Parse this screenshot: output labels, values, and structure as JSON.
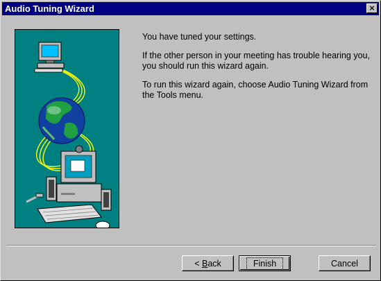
{
  "window": {
    "title": "Audio Tuning Wizard",
    "close_label": "×"
  },
  "illustration": {
    "icons": [
      "computer-icon",
      "globe-icon",
      "desktop-computer-icon",
      "speaker-icon",
      "microphone-icon",
      "mouse-icon",
      "keyboard-icon"
    ],
    "colors": {
      "background": "#008080",
      "cable": "#ffff00"
    }
  },
  "content": {
    "paragraphs": [
      "You have tuned your settings.",
      "If the other person in your meeting has trouble hearing you, you should run this wizard again.",
      "To run this wizard again, choose Audio Tuning Wizard from the Tools menu."
    ]
  },
  "buttons": {
    "back_prefix": "< ",
    "back_mnemonic": "B",
    "back_rest": "ack",
    "finish_label": "Finish",
    "cancel_label": "Cancel"
  },
  "colors": {
    "titlebar": "#000080",
    "face": "#c0c0c0"
  }
}
